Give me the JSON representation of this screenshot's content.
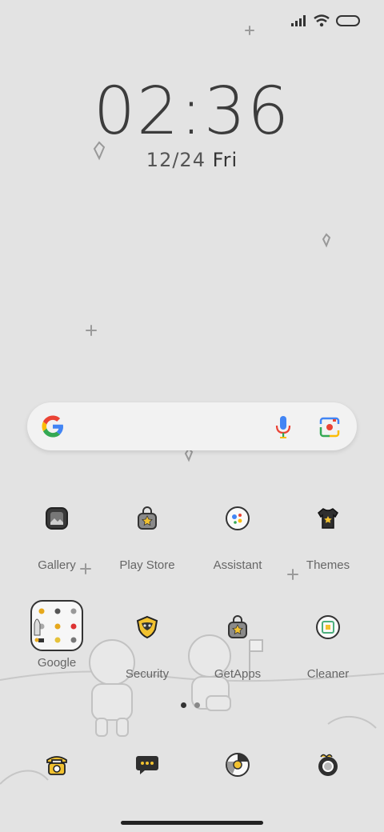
{
  "status_bar": {
    "signal_icon": "signal-icon",
    "wifi_icon": "wifi-icon",
    "battery_icon": "battery-icon"
  },
  "clock": {
    "time": "02:36",
    "date": "12/24",
    "weekday": "Fri"
  },
  "search_bar": {
    "logo_icon": "google-g-icon",
    "mic_icon": "mic-icon",
    "lens_icon": "lens-icon"
  },
  "apps": {
    "row1": [
      {
        "label": "Gallery",
        "icon": "gallery-icon"
      },
      {
        "label": "Play Store",
        "icon": "play-store-icon"
      },
      {
        "label": "Assistant",
        "icon": "assistant-icon"
      },
      {
        "label": "Themes",
        "icon": "themes-icon"
      }
    ],
    "row2": [
      {
        "label": "Google",
        "icon": "google-folder-icon"
      },
      {
        "label": "Security",
        "icon": "security-icon"
      },
      {
        "label": "GetApps",
        "icon": "getapps-icon"
      },
      {
        "label": "Cleaner",
        "icon": "cleaner-icon"
      }
    ]
  },
  "page_indicator": {
    "pages": 2,
    "active": 1
  },
  "dock": [
    {
      "icon": "phone-icon"
    },
    {
      "icon": "messages-icon"
    },
    {
      "icon": "browser-icon"
    },
    {
      "icon": "camera-icon"
    }
  ]
}
